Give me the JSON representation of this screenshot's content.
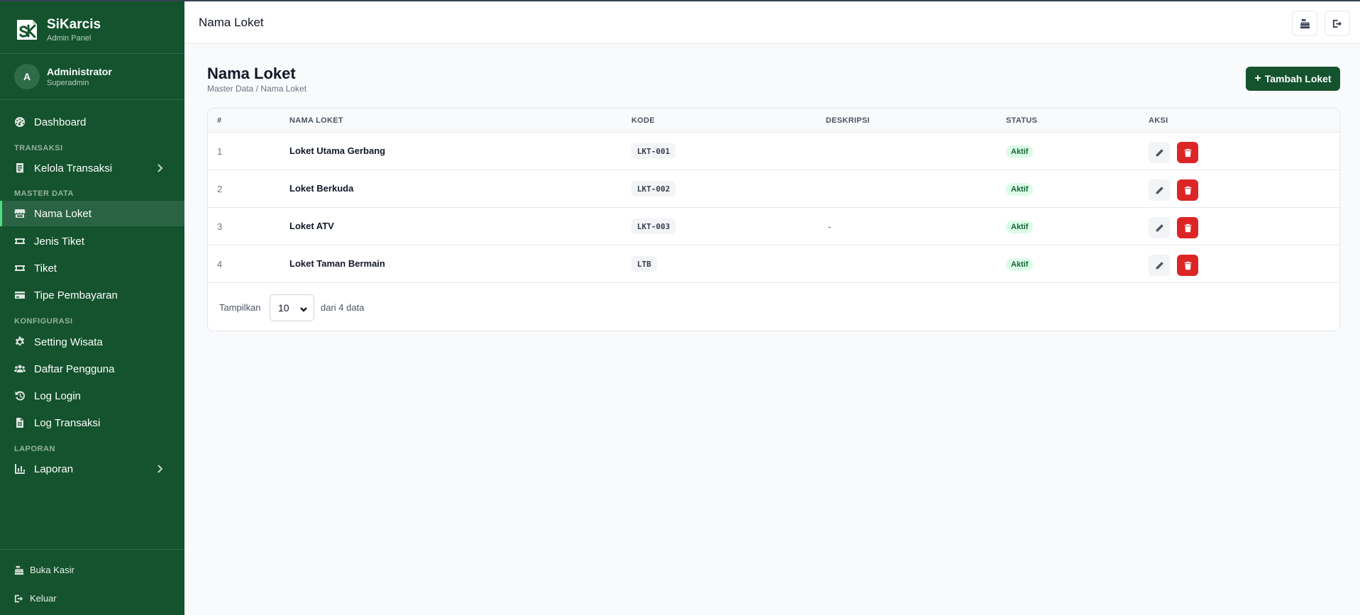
{
  "brand": {
    "name": "SiKarcis",
    "subtitle": "Admin Panel",
    "logo": "sk-logo"
  },
  "user": {
    "initial": "A",
    "name": "Administrator",
    "role": "Superadmin"
  },
  "sidebar": {
    "dashboard": {
      "label": "Dashboard",
      "icon": "dashboard-icon"
    },
    "sections": {
      "transaksi": "TRANSAKSI",
      "master_data": "MASTER DATA",
      "konfigurasi": "KONFIGURASI",
      "laporan": "LAPORAN"
    },
    "items": {
      "kelola_transaksi": "Kelola Transaksi",
      "nama_loket": "Nama Loket",
      "jenis_tiket": "Jenis Tiket",
      "tiket": "Tiket",
      "tipe_pembayaran": "Tipe Pembayaran",
      "setting_wisata": "Setting Wisata",
      "daftar_pengguna": "Daftar Pengguna",
      "log_login": "Log Login",
      "log_transaksi": "Log Transaksi",
      "laporan": "Laporan"
    },
    "active_item": "nama_loket",
    "bottom": {
      "buka_kasir": "Buka Kasir",
      "keluar": "Keluar"
    }
  },
  "header": {
    "title": "Nama Loket"
  },
  "page": {
    "title": "Nama Loket",
    "breadcrumb": "Master Data / Nama Loket",
    "add_button": "Tambah Loket"
  },
  "table": {
    "columns": [
      "#",
      "NAMA LOKET",
      "KODE",
      "DESKRIPSI",
      "STATUS",
      "AKSI"
    ],
    "rows": [
      {
        "no": "1",
        "name": "Loket Utama Gerbang",
        "code": "LKT-001",
        "description": "",
        "status": "Aktif"
      },
      {
        "no": "2",
        "name": "Loket Berkuda",
        "code": "LKT-002",
        "description": "",
        "status": "Aktif"
      },
      {
        "no": "3",
        "name": "Loket ATV",
        "code": "LKT-003",
        "description": "-",
        "status": "Aktif"
      },
      {
        "no": "4",
        "name": "Loket Taman Bermain",
        "code": "LTB",
        "description": "",
        "status": "Aktif"
      }
    ]
  },
  "pagination": {
    "show_label": "Tampilkan",
    "page_size": "10",
    "count_label": "dari 4 data"
  },
  "colors": {
    "sidebar_bg": "#14532d",
    "active_item_bg": "#2a6343",
    "active_accent": "#4ade80",
    "primary_button": "#14532d",
    "delete_button": "#dc2626",
    "status_badge_bg": "#dcfce7",
    "status_badge_text": "#166534"
  }
}
